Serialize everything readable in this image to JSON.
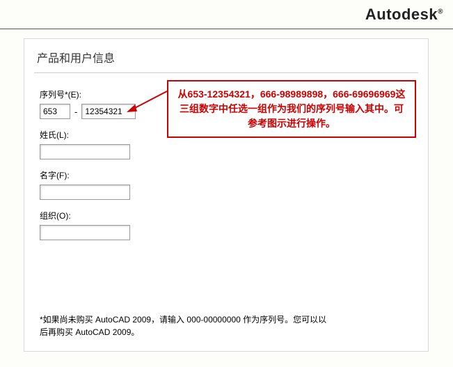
{
  "brand": "Autodesk",
  "panel": {
    "title": "产品和用户信息"
  },
  "form": {
    "serial": {
      "label": "序列号*(E):",
      "prefix_value": "653",
      "dash": "-",
      "suffix_value": "12354321"
    },
    "lastName": {
      "label": "姓氏(L):",
      "value": ""
    },
    "firstName": {
      "label": "名字(F):",
      "value": ""
    },
    "organization": {
      "label": "组织(O):",
      "value": ""
    }
  },
  "callout": {
    "text": "从653-12354321，666-98989898，666-69696969这三组数字中任选一组作为我们的序列号输入其中。可参考图示进行操作。"
  },
  "footnote": "*如果尚未购买 AutoCAD 2009，请输入 000-00000000 作为序列号。您可以以后再购买 AutoCAD 2009。"
}
